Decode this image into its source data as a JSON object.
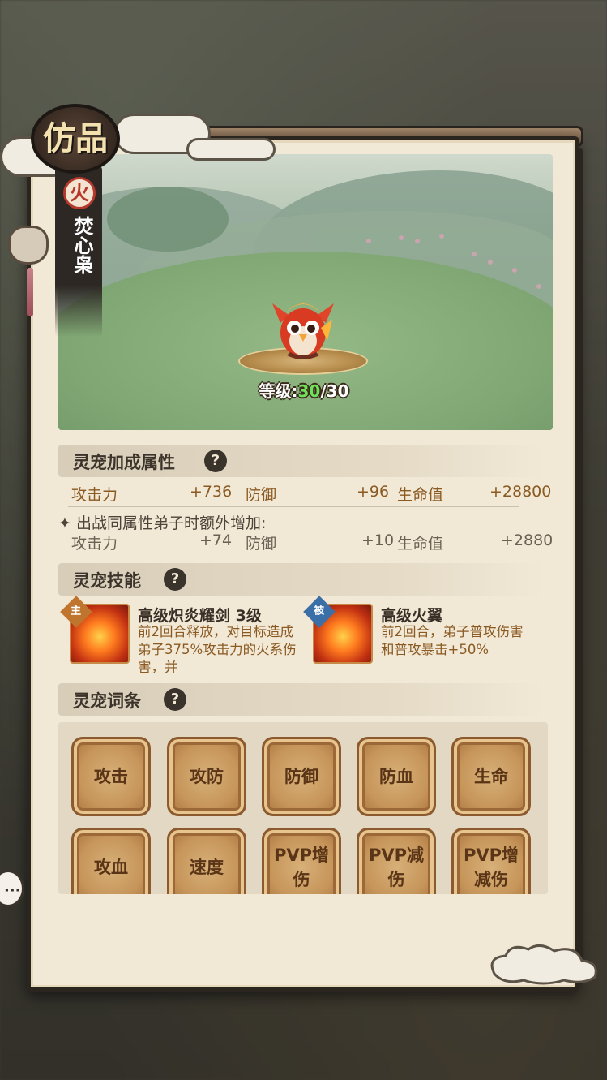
{
  "grade_badge": "仿品",
  "pet": {
    "element": "火",
    "name": "焚心枭",
    "level_label": "等级:",
    "level_current": "30",
    "level_sep": "/",
    "level_max": "30"
  },
  "bonus_section": {
    "title": "灵宠加成属性",
    "help": "?",
    "base_stats": [
      {
        "label": "攻击力",
        "value": "+736"
      },
      {
        "label": "防御",
        "value": "+96"
      },
      {
        "label": "生命值",
        "value": "+28800"
      }
    ],
    "extra_label": "出战同属性弟子时额外增加:",
    "extra_marker": "✦",
    "extra_stats": [
      {
        "label": "攻击力",
        "value": "+74"
      },
      {
        "label": "防御",
        "value": "+10"
      },
      {
        "label": "生命值",
        "value": "+2880"
      }
    ]
  },
  "skills_section": {
    "title": "灵宠技能",
    "help": "?",
    "skills": [
      {
        "tag": "主",
        "name": "高级炽炎耀剑 3级",
        "desc": "前2回合释放，对目标造成弟子375%攻击力的火系伤害，并"
      },
      {
        "tag": "被",
        "name": "高级火翼",
        "desc": "前2回合，弟子普攻伤害和普攻暴击+50%"
      }
    ]
  },
  "traits_section": {
    "title": "灵宠词条",
    "help": "?",
    "traits": [
      "攻击",
      "攻防",
      "防御",
      "防血",
      "生命",
      "攻血",
      "速度",
      "PVP增伤",
      "PVP减伤",
      "PVP增减伤"
    ]
  },
  "side_bubble": "···",
  "colors": {
    "accent_gold": "#8a5a22",
    "level_green": "#6fe15a",
    "fire_red": "#b6382c",
    "active_tag": "#c0752f",
    "passive_tag": "#3b6fa8"
  }
}
